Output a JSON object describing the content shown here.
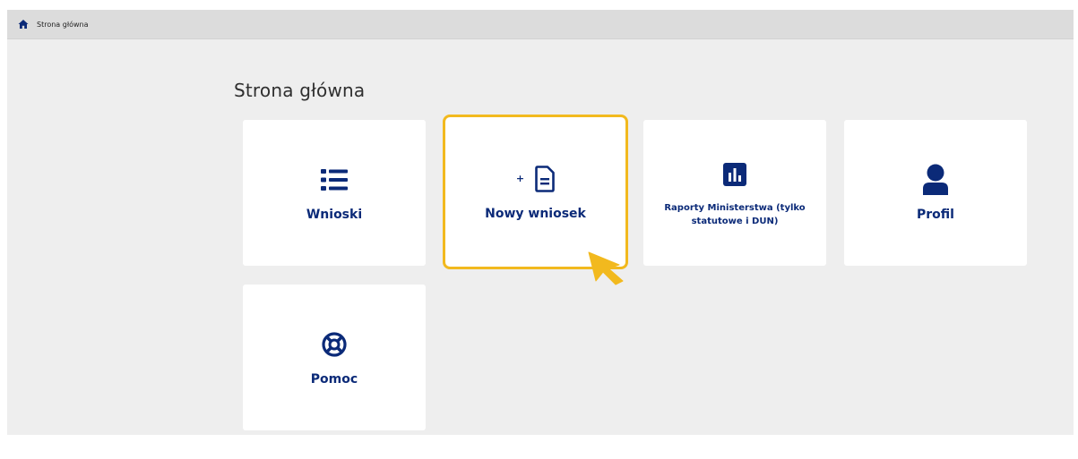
{
  "breadcrumb": {
    "home_label": "Strona główna"
  },
  "page": {
    "title": "Strona główna"
  },
  "tiles": [
    {
      "label": "Wnioski",
      "icon": "list-icon"
    },
    {
      "plus": "+",
      "label": "Nowy wniosek",
      "icon": "document-icon",
      "highlighted": true
    },
    {
      "label": "Raporty Ministerstwa (tylko statutowe i DUN)",
      "icon": "bar-chart-icon"
    },
    {
      "label": "Profil",
      "icon": "user-icon"
    },
    {
      "label": "Pomoc",
      "icon": "lifebuoy-icon"
    }
  ],
  "colors": {
    "accent": "#0b2a78",
    "highlight": "#f2b91e",
    "background": "#eeeeee",
    "breadcrumb_bar": "#dcdcdc"
  }
}
